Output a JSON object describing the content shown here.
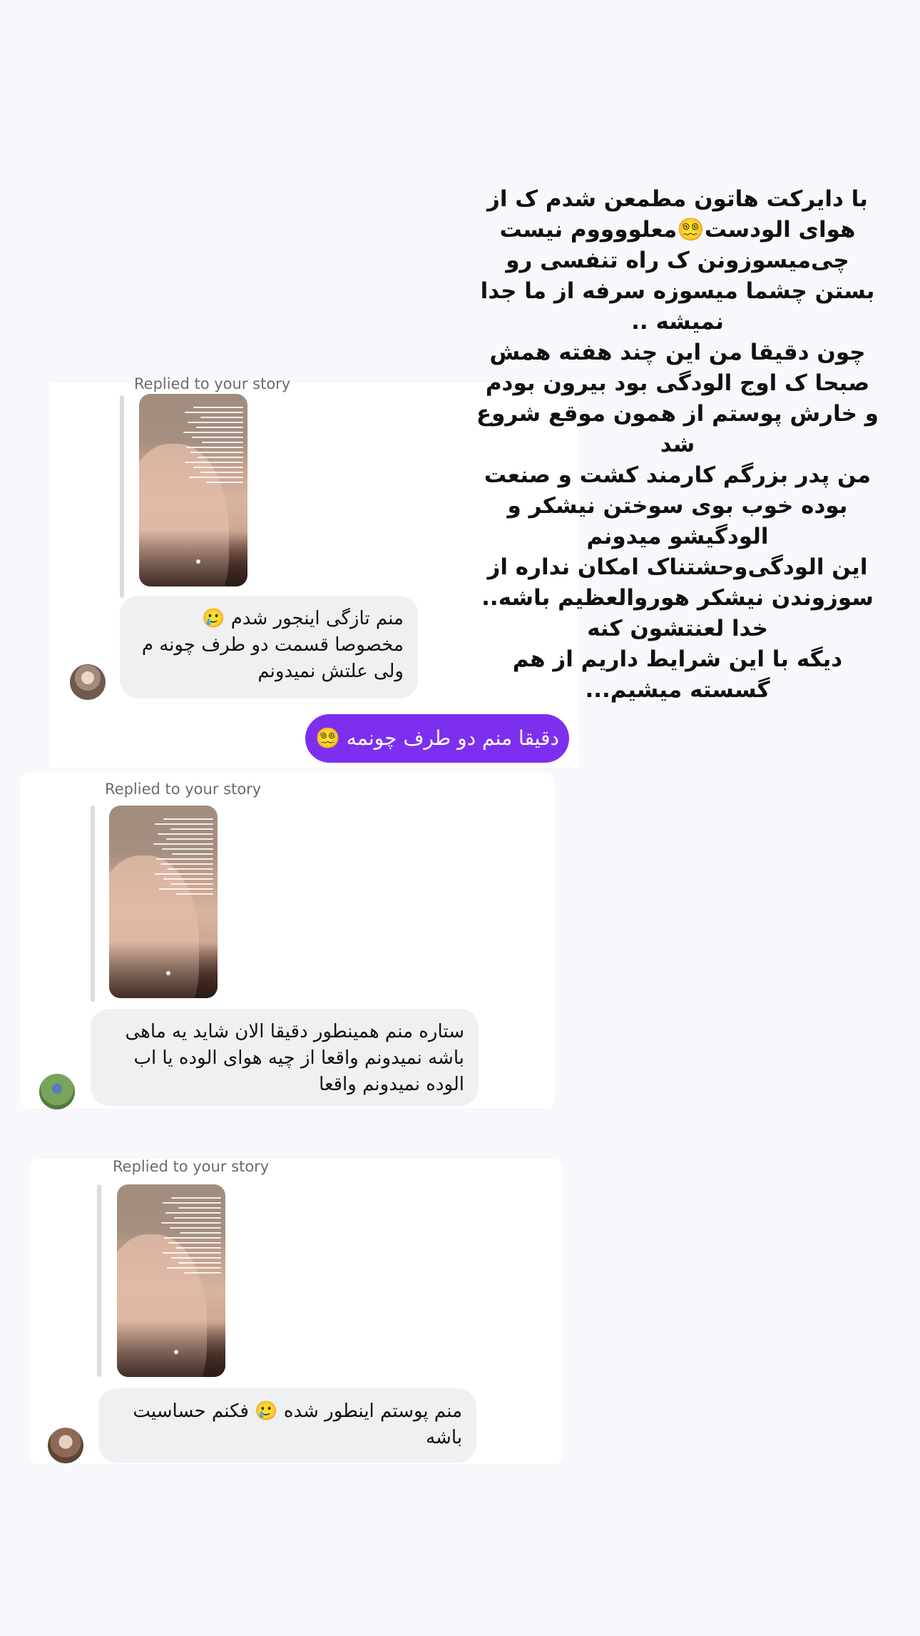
{
  "story_text_lines": [
    "با دایرکت هاتون مطمعن شدم ک از",
    "هوای الودست😵‍💫معلووووم نیست",
    "چی‌میسوزونن ک راه تنفسی رو",
    "بستن چشما میسوزه سرفه از ما جدا",
    "نمیشه ..",
    "چون دقیقا من این چند هفته همش",
    "صبحا ک اوج الودگی بود بیرون بودم",
    "و خارش پوستم از همون موقع شروع",
    "شد",
    "من پدر بزرگم کارمند کشت و صنعت",
    "بوده خوب بوی سوختن نیشکر و",
    "الودگیشو میدونم",
    "این الودگی‌وحشتناک امکان نداره از",
    "سوزوندن نیشکر هوروالعظیم باشه..",
    "خدا لعنتشون کنه",
    "دیگه با این شرایط داریم از هم",
    "گسسته میشیم..."
  ],
  "replied_label": "Replied to your story",
  "messages": [
    {
      "text": "منم تازگی اینجور شدم 🥲\nمخصوصا قسمت دو طرف چونه م\nولی علتش نمیدونم",
      "reply": "دقیقا منم دو طرف چونمه 😵‍💫"
    },
    {
      "text": "ستاره منم همینطور دقیقا الان شاید یه ماهی باشه نمیدونم واقعا از چیه هوای الوده یا اب الوده نمیدونم واقعا"
    },
    {
      "text": "منم پوستم اینطور شده 🥲 فکنم حساسیت باشه"
    }
  ],
  "icons": {
    "avatar1": "profile-photo",
    "avatar2": "profile-photo",
    "avatar3": "profile-photo",
    "thumb": "story-thumbnail"
  }
}
